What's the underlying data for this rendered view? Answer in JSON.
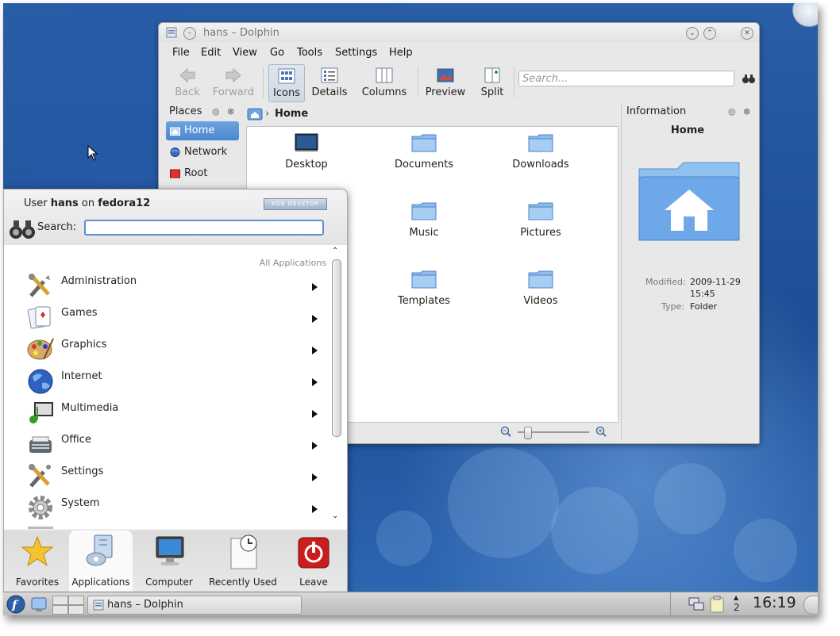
{
  "dolphin": {
    "title": "hans – Dolphin",
    "menu": [
      "File",
      "Edit",
      "View",
      "Go",
      "Tools",
      "Settings",
      "Help"
    ],
    "toolbar": {
      "back": "Back",
      "forward": "Forward",
      "icons": "Icons",
      "details": "Details",
      "columns": "Columns",
      "preview": "Preview",
      "split": "Split"
    },
    "search_placeholder": "Search...",
    "places": {
      "title": "Places",
      "items": [
        "Home",
        "Network",
        "Root"
      ]
    },
    "breadcrumb": "Home",
    "files": [
      "Desktop",
      "Documents",
      "Downloads",
      "Music",
      "Pictures",
      "Templates",
      "Videos"
    ],
    "information": {
      "title": "Information",
      "name": "Home",
      "modified_label": "Modified:",
      "modified_date": "2009-11-29",
      "modified_time": "15:45",
      "type_label": "Type:",
      "type_value": "Folder"
    },
    "zoom_level": 0.1
  },
  "kickoff": {
    "user_prefix": "User ",
    "user_name": "hans",
    "user_mid": " on ",
    "host": "fedora12",
    "logo_text": "KDE DESKTOP",
    "search_label": "Search:",
    "search_value": "",
    "all_apps": "All Applications",
    "categories": [
      "Administration",
      "Games",
      "Graphics",
      "Internet",
      "Multimedia",
      "Office",
      "Settings",
      "System"
    ],
    "tabs": [
      "Favorites",
      "Applications",
      "Computer",
      "Recently Used",
      "Leave"
    ]
  },
  "taskbar": {
    "task": "hans – Dolphin",
    "desktop_num": "2",
    "clock": "16:19"
  },
  "colors": {
    "selection": "#4a86cf",
    "folder": "#79aee6",
    "desktop": "#1f4f8f"
  }
}
